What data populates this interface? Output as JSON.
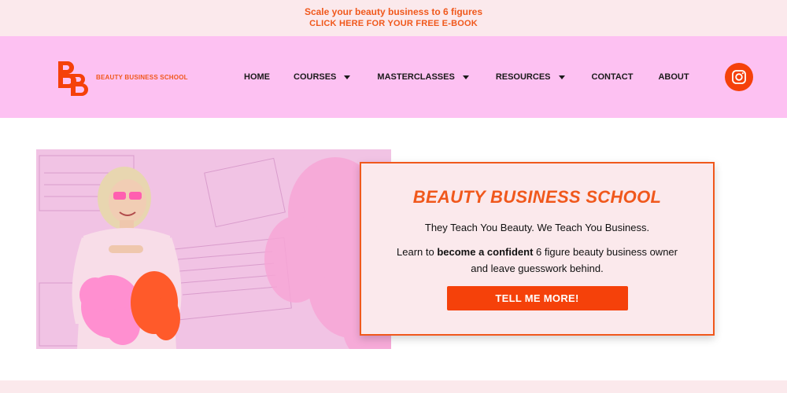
{
  "promo": {
    "line1": "Scale your beauty business to 6 figures",
    "line2": "CLICK HERE FOR YOUR FREE E-BOOK"
  },
  "logo": {
    "text": "BEAUTY BUSINESS SCHOOL"
  },
  "nav": {
    "items": [
      {
        "label": "HOME",
        "dropdown": false
      },
      {
        "label": "COURSES",
        "dropdown": true
      },
      {
        "label": "MASTERCLASSES",
        "dropdown": true
      },
      {
        "label": "RESOURCES",
        "dropdown": true
      },
      {
        "label": "CONTACT",
        "dropdown": false
      },
      {
        "label": "ABOUT",
        "dropdown": false
      }
    ]
  },
  "social": {
    "icon": "instagram-icon"
  },
  "hero": {
    "title": "BEAUTY BUSINESS SCHOOL",
    "tagline": "They Teach You Beauty. We Teach You Business.",
    "body_pre": "Learn to ",
    "body_bold": "become a confident",
    "body_post": " 6 figure beauty business owner and leave guesswork behind.",
    "cta": "TELL ME MORE!"
  },
  "colors": {
    "accent": "#f0581c",
    "cta": "#f5410a",
    "header_bg": "#fdc1f2",
    "promo_bg": "#fbe9ec"
  }
}
